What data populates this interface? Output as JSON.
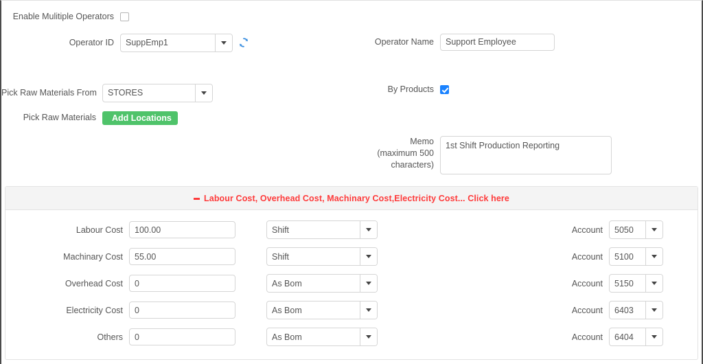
{
  "form": {
    "enable_multiple_operators": {
      "label": "Enable Mulitiple Operators",
      "checked": false
    },
    "operator_id": {
      "label": "Operator ID",
      "value": "SuppEmp1",
      "refresh_icon": "refresh-icon"
    },
    "operator_name": {
      "label": "Operator Name",
      "value": "Support Employee"
    },
    "pick_raw_materials_from": {
      "label": "Pick Raw Materials From",
      "value": "STORES"
    },
    "pick_raw_materials": {
      "label": "Pick Raw Materials",
      "button_label": "Add Locations"
    },
    "by_products": {
      "label": "By Products",
      "checked": true
    },
    "memo": {
      "label_line1": "Memo",
      "label_line2": "(maximum 500",
      "label_line3": "characters)",
      "value": "1st Shift Production Reporting",
      "placeholder": ""
    }
  },
  "cost_panel": {
    "header_text": "Labour Cost, Overhead Cost, Machinary Cost,Electricity Cost... Click here",
    "header_icon": "minus-icon",
    "account_label": "Account",
    "rows": [
      {
        "label": "Labour Cost",
        "amount": "100.00",
        "mode": "Shift",
        "account": "5050"
      },
      {
        "label": "Machinary Cost",
        "amount": "55.00",
        "mode": "Shift",
        "account": "5100"
      },
      {
        "label": "Overhead Cost",
        "amount": "0",
        "mode": "As Bom",
        "account": "5150"
      },
      {
        "label": "Electricity Cost",
        "amount": "0",
        "mode": "As Bom",
        "account": "6403"
      },
      {
        "label": "Others",
        "amount": "0",
        "mode": "As Bom",
        "account": "6404"
      }
    ]
  },
  "colors": {
    "accent_red": "#fe3b3b",
    "button_green": "#4fc36a",
    "checkbox_blue": "#1a82ff",
    "refresh_blue": "#3b8fe0",
    "label_gray": "#555555",
    "border_gray": "#d5d5d5",
    "panel_head_gray": "#f4f4f4"
  }
}
